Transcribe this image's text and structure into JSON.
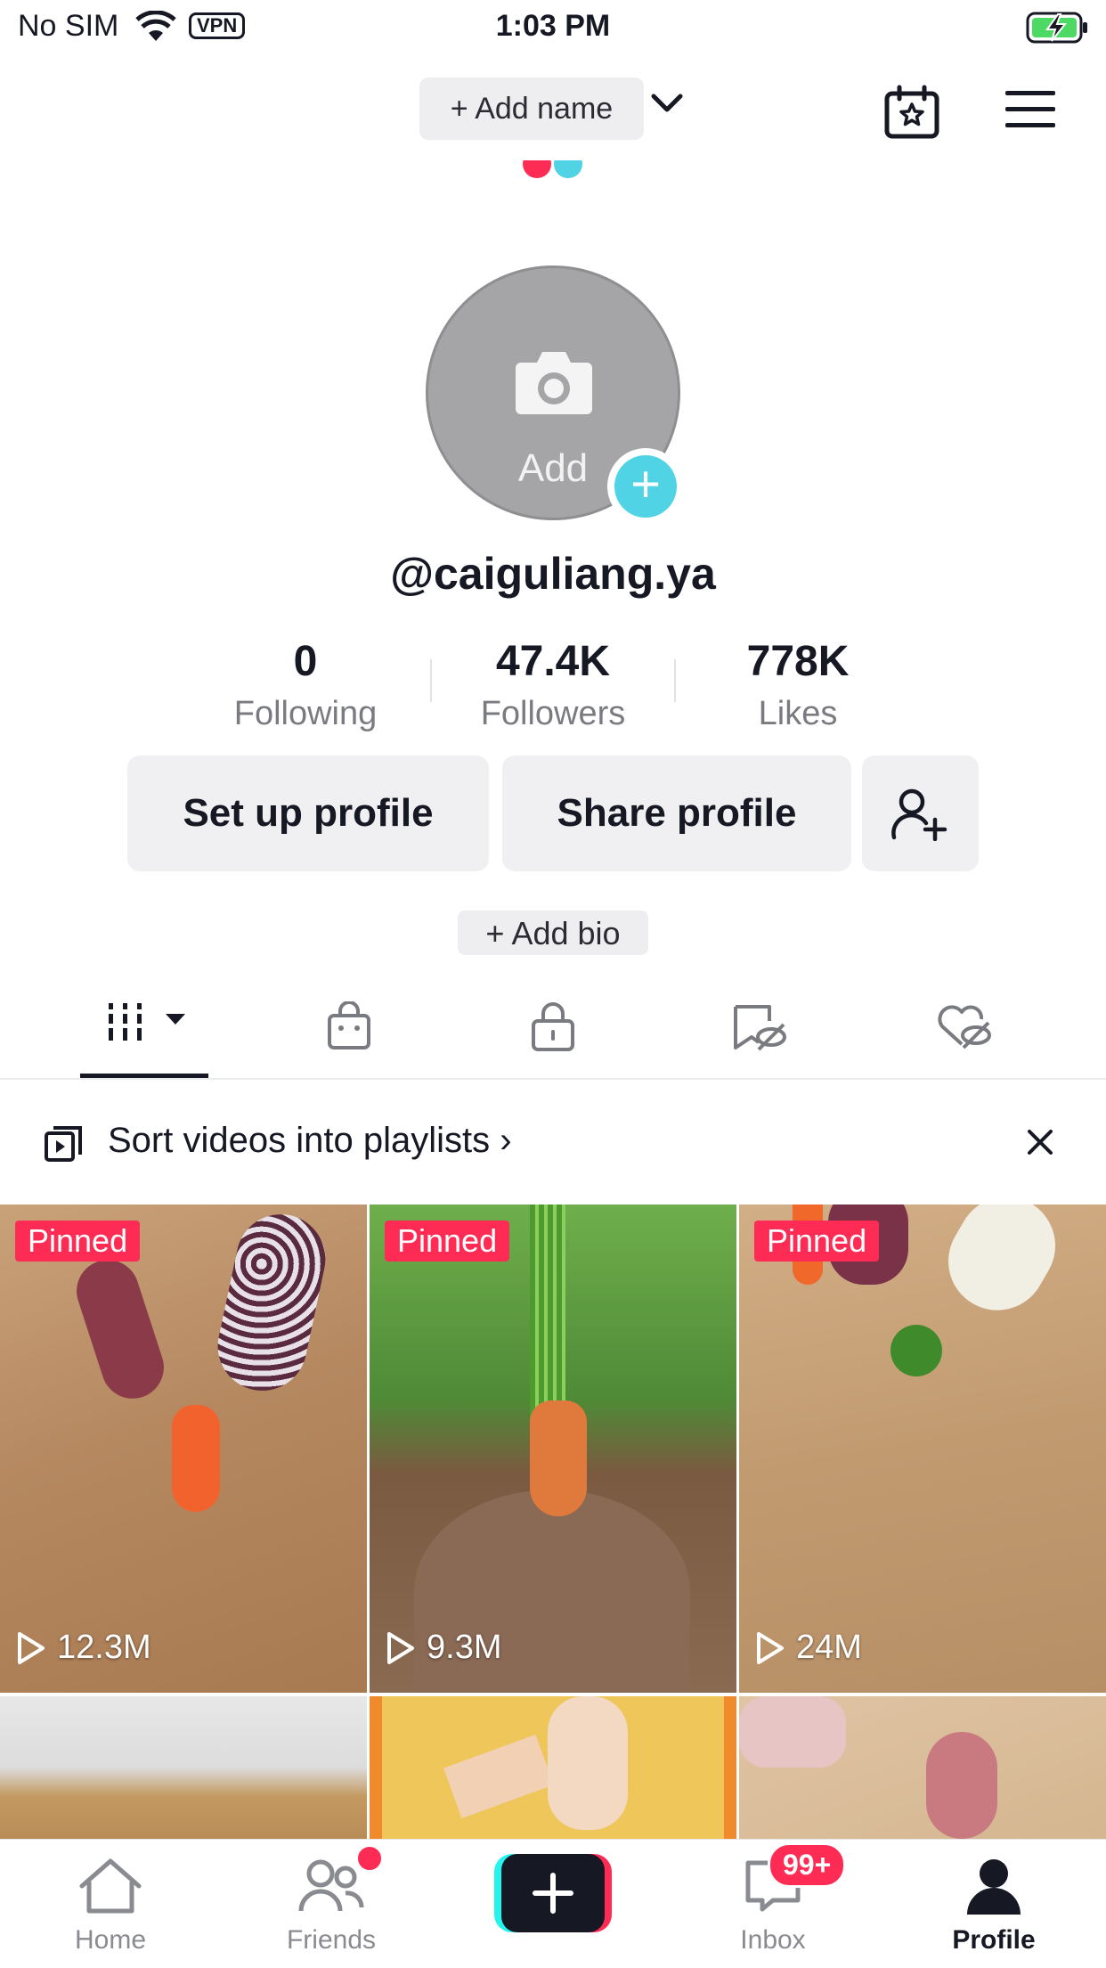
{
  "status_bar": {
    "carrier": "No SIM",
    "vpn": "VPN",
    "time": "1:03 PM"
  },
  "header": {
    "add_name": "+ Add name"
  },
  "avatar": {
    "label": "Add"
  },
  "profile": {
    "username": "@caiguliang.ya",
    "add_bio": "+ Add bio"
  },
  "stats": [
    {
      "value": "0",
      "label": "Following"
    },
    {
      "value": "47.4K",
      "label": "Followers"
    },
    {
      "value": "778K",
      "label": "Likes"
    }
  ],
  "actions": {
    "setup": "Set up profile",
    "share": "Share profile"
  },
  "tabs": [
    "videos-icon",
    "shop-icon",
    "private-lock-icon",
    "reposts-icon",
    "liked-hidden-icon"
  ],
  "banner": {
    "text": "Sort videos into playlists ›"
  },
  "videos": [
    {
      "pinned": "Pinned",
      "views": "12.3M"
    },
    {
      "pinned": "Pinned",
      "views": "9.3M"
    },
    {
      "pinned": "Pinned",
      "views": "24M"
    },
    {
      "pinned": "",
      "views": ""
    },
    {
      "pinned": "",
      "views": ""
    },
    {
      "pinned": "",
      "views": ""
    }
  ],
  "nav": {
    "home": "Home",
    "friends": "Friends",
    "inbox": "Inbox",
    "inbox_badge": "99+",
    "profile": "Profile"
  },
  "colors": {
    "accent": "#fe2c55",
    "cyan": "#4fd3e5",
    "text": "#161823",
    "muted": "#7a7b80"
  }
}
